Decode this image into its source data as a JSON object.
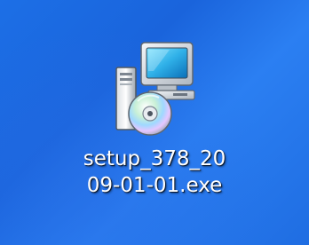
{
  "desktop": {
    "background_color": "#1f6fe6",
    "icon": {
      "icon_name": "installer-setup-icon",
      "label_line1": "setup_378_20",
      "label_line2": "09-01-01.exe"
    }
  }
}
